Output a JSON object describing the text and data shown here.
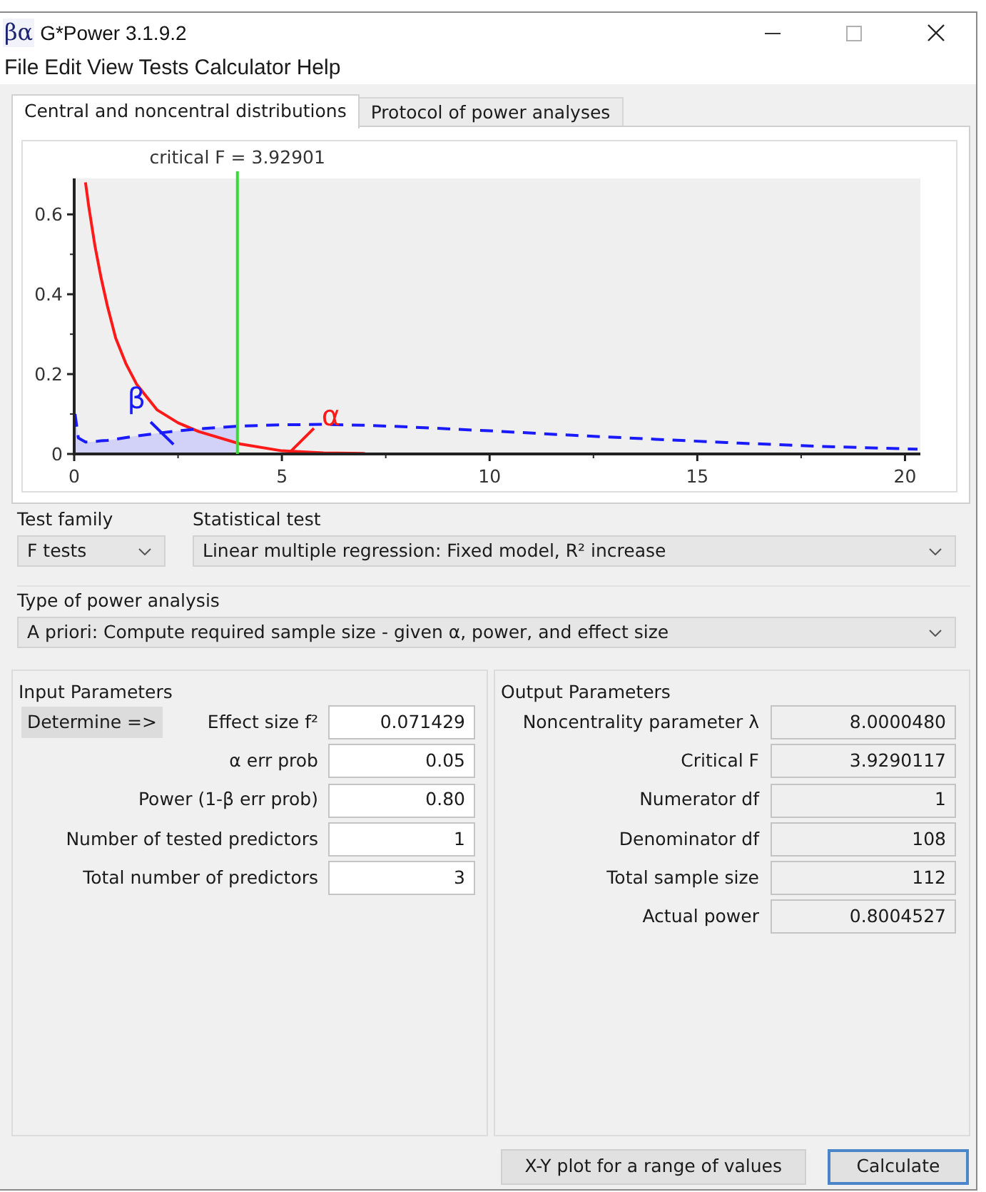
{
  "window": {
    "logo": "βα",
    "title": "G*Power 3.1.9.2"
  },
  "menu": [
    "File",
    "Edit",
    "View",
    "Tests",
    "Calculator",
    "Help"
  ],
  "tabs": [
    {
      "label": "Central and noncentral distributions",
      "selected": true
    },
    {
      "label": "Protocol of power analyses",
      "selected": false
    }
  ],
  "plot": {
    "chart_data": {
      "type": "line",
      "x": [
        0.02,
        0.1,
        0.27,
        0.35,
        0.5,
        0.65,
        0.8,
        1,
        1.25,
        1.5,
        2,
        2.5,
        3,
        4,
        5,
        6,
        7,
        8,
        10,
        12,
        14,
        16,
        18,
        20,
        20.3
      ],
      "series": [
        {
          "color": "#ff1a1a",
          "line_style": "solid",
          "values": [
            null,
            null,
            0.68,
            0.62,
            0.52,
            0.44,
            0.37,
            0.29,
            0.225,
            0.175,
            0.11,
            0.078,
            0.056,
            0.025,
            0.008,
            0.003,
            0.001,
            null,
            null,
            null,
            null,
            null,
            null,
            null,
            null
          ]
        },
        {
          "color": "#1a1aff",
          "line_style": "dashed",
          "values": [
            0.1,
            0.04,
            0.03,
            0.03,
            0.031,
            0.033,
            0.034,
            0.037,
            0.041,
            0.045,
            0.052,
            0.058,
            0.063,
            0.07,
            0.073,
            0.074,
            0.072,
            0.068,
            0.058,
            0.047,
            0.037,
            0.027,
            0.019,
            0.013,
            0.012
          ]
        }
      ],
      "xlim": [
        0,
        20.37
      ],
      "ylim": [
        0,
        0.69
      ],
      "xticks": [
        0,
        5,
        10,
        15,
        20
      ],
      "yticks": [
        0,
        0.2,
        0.4,
        0.6
      ],
      "ref_lines": [
        {
          "axis": "x",
          "value": 3.92901,
          "label": "critical F = 3.92901",
          "color": "#33dd33"
        }
      ],
      "annotations": [
        "β",
        "α"
      ]
    }
  },
  "test_family": {
    "label": "Test family",
    "value": "F tests"
  },
  "statistical_test": {
    "label": "Statistical test",
    "value": "Linear multiple regression: Fixed model, R² increase"
  },
  "power_analysis": {
    "label": "Type of power analysis",
    "value": "A priori: Compute required sample size - given α, power, and effect size"
  },
  "input_parameters": {
    "title": "Input Parameters",
    "determine_button": "Determine =>",
    "fields": [
      {
        "label": "Effect size f²",
        "value": "0.071429"
      },
      {
        "label": "α err prob",
        "value": "0.05"
      },
      {
        "label": "Power (1-β err prob)",
        "value": "0.80"
      },
      {
        "label": "Number of tested predictors",
        "value": "1"
      },
      {
        "label": "Total number of predictors",
        "value": "3"
      }
    ]
  },
  "output_parameters": {
    "title": "Output Parameters",
    "fields": [
      {
        "label": "Noncentrality parameter λ",
        "value": "8.0000480"
      },
      {
        "label": "Critical F",
        "value": "3.9290117"
      },
      {
        "label": "Numerator df",
        "value": "1"
      },
      {
        "label": "Denominator df",
        "value": "108"
      },
      {
        "label": "Total sample size",
        "value": "112"
      },
      {
        "label": "Actual power",
        "value": "0.8004527"
      }
    ]
  },
  "buttons": [
    {
      "label": "X-Y plot for a range of values",
      "default": false
    },
    {
      "label": "Calculate",
      "default": true
    }
  ]
}
